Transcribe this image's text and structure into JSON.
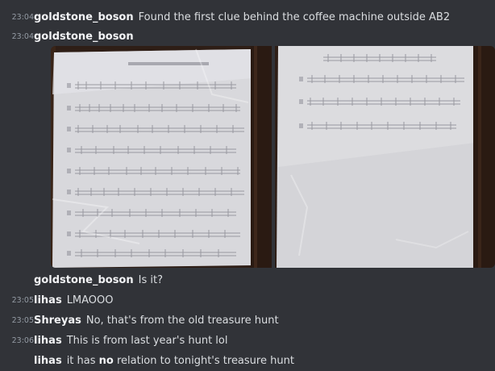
{
  "messages": [
    {
      "time": "23:04",
      "user": "goldstone_boson",
      "text": "Found the first clue behind the coffee machine outside AB2"
    },
    {
      "time": "23:04",
      "user": "goldstone_boson",
      "text": ""
    },
    {
      "time": "",
      "user": "goldstone_boson",
      "text": "Is it?"
    },
    {
      "time": "23:05",
      "user": "lihas",
      "text": "LMAOOO"
    },
    {
      "time": "23:05",
      "user": "Shreyas",
      "text": "No, that's from the old treasure hunt"
    },
    {
      "time": "23:06",
      "user": "lihas",
      "text": "This is from last year's hunt lol"
    },
    {
      "time": "",
      "user": "lihas",
      "text_before": "it has ",
      "text_bold": "no",
      "text_after": " relation to tonight's treasure hunt"
    }
  ],
  "attachments": [
    {
      "icon": "photo-clue-sheet-1"
    },
    {
      "icon": "photo-clue-sheet-2"
    }
  ],
  "colors": {
    "background": "#313338",
    "username": "#f2f3f5",
    "message_text": "#dbdee1",
    "timestamp": "#949ba4",
    "paper": "#dcdcdf",
    "wood": "#2e1e16"
  }
}
